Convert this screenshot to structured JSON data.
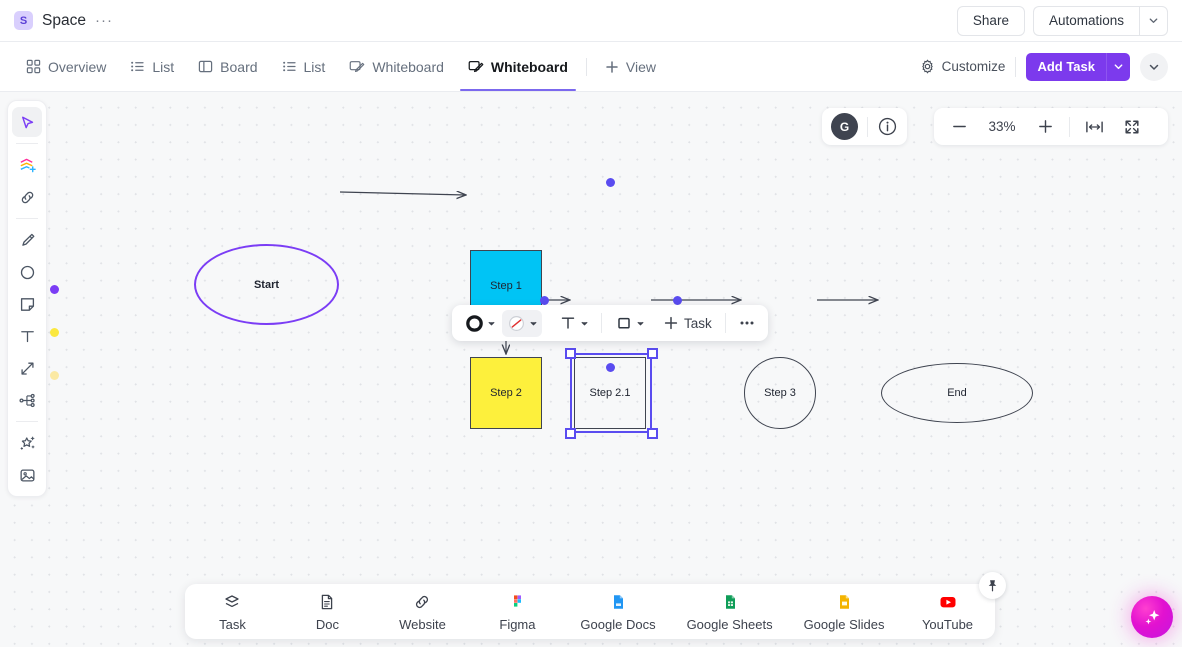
{
  "topbar": {
    "space_initial": "S",
    "space_name": "Space",
    "more_dots": "···",
    "share_label": "Share",
    "automations_label": "Automations"
  },
  "nav": {
    "tabs": [
      {
        "label": "Overview",
        "icon": "grid-icon",
        "active": false
      },
      {
        "label": "List",
        "icon": "list-icon",
        "active": false
      },
      {
        "label": "Board",
        "icon": "board-icon",
        "active": false
      },
      {
        "label": "List",
        "icon": "list-icon",
        "active": false
      },
      {
        "label": "Whiteboard",
        "icon": "whiteboard-icon",
        "active": false
      },
      {
        "label": "Whiteboard",
        "icon": "whiteboard-icon",
        "active": true
      }
    ],
    "view_label": "View",
    "customize_label": "Customize",
    "add_task_label": "Add Task",
    "accent_color": "#7c3aed"
  },
  "canvas": {
    "avatar_initial": "G",
    "zoom_level": "33%",
    "background_color": "#f7f8f9",
    "grid_dot_color": "#e0e2e6"
  },
  "tool_rail": {
    "tools": [
      {
        "name": "select-cursor-icon",
        "active": true
      },
      {
        "name": "shapes-stack-add-icon",
        "active": false
      },
      {
        "name": "link-icon",
        "active": false
      },
      {
        "name": "marker-pen-icon",
        "active": false
      },
      {
        "name": "circle-shape-icon",
        "active": false
      },
      {
        "name": "sticky-note-icon",
        "active": false
      },
      {
        "name": "text-icon",
        "active": false
      },
      {
        "name": "connector-arrow-icon",
        "active": false
      },
      {
        "name": "mindmap-icon",
        "active": false
      },
      {
        "name": "magic-wand-icon",
        "active": false
      },
      {
        "name": "image-icon",
        "active": false
      }
    ],
    "swatches": [
      "#7b3df5",
      "#fbe83f",
      "#fbe9a3"
    ]
  },
  "shape_toolbar": {
    "items": [
      {
        "name": "fill-color-icon",
        "label": ""
      },
      {
        "name": "border-style-icon",
        "label": "",
        "selected": true
      },
      {
        "name": "text-style-icon",
        "label": ""
      },
      {
        "name": "shape-style-icon",
        "label": ""
      }
    ],
    "task_label": "Task",
    "more_label": "•••"
  },
  "whiteboard": {
    "shapes": [
      {
        "id": "start",
        "label": "Start",
        "type": "ellipse",
        "fill": "none",
        "stroke": "#7b3df5"
      },
      {
        "id": "step1",
        "label": "Step 1",
        "type": "rectangle",
        "fill": "#00c4f5",
        "stroke": "#3f4450"
      },
      {
        "id": "step2",
        "label": "Step 2",
        "type": "rectangle",
        "fill": "#fdf03c",
        "stroke": "#3f4450"
      },
      {
        "id": "step21",
        "label": "Step 2.1",
        "type": "rectangle",
        "fill": "none",
        "stroke": "#3f4450",
        "selected": true
      },
      {
        "id": "step3",
        "label": "Step 3",
        "type": "circle",
        "fill": "none",
        "stroke": "#3f4450"
      },
      {
        "id": "end",
        "label": "End",
        "type": "ellipse",
        "fill": "none",
        "stroke": "#3f4450"
      }
    ],
    "selection_color": "#5a4cf0"
  },
  "dock": {
    "items": [
      {
        "label": "Task",
        "icon": "task-stack-icon"
      },
      {
        "label": "Doc",
        "icon": "doc-icon"
      },
      {
        "label": "Website",
        "icon": "link-icon"
      },
      {
        "label": "Figma",
        "icon": "figma-icon"
      },
      {
        "label": "Google Docs",
        "icon": "google-docs-icon"
      },
      {
        "label": "Google Sheets",
        "icon": "google-sheets-icon"
      },
      {
        "label": "Google Slides",
        "icon": "google-slides-icon"
      },
      {
        "label": "YouTube",
        "icon": "youtube-icon"
      }
    ]
  },
  "fab": {
    "icon": "ai-sparkle-icon",
    "color": "#e212d0"
  }
}
